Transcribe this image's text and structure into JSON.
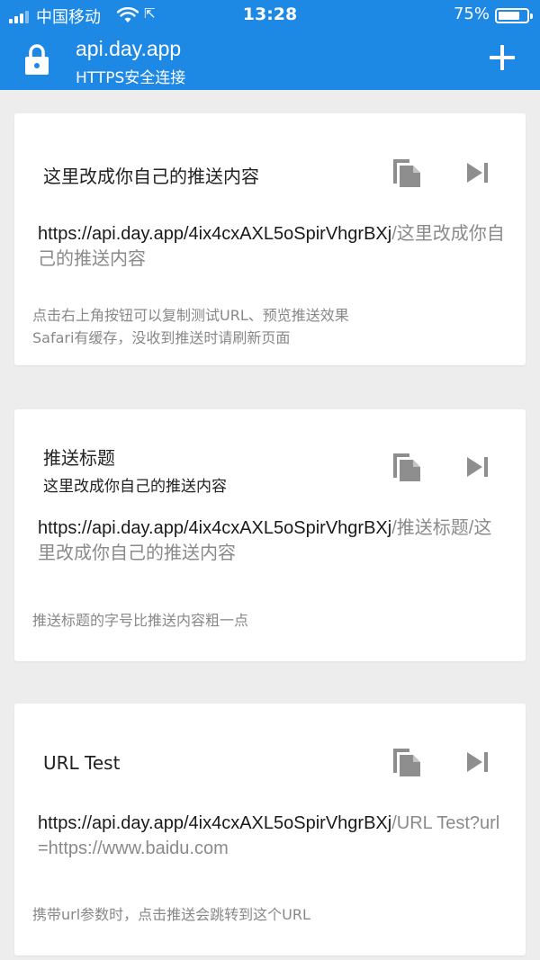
{
  "status_bar": {
    "carrier": "中国移动",
    "time": "13:28",
    "battery": "75%",
    "battery_level": 0.75
  },
  "header": {
    "site": "api.day.app",
    "security": "HTTPS安全连接"
  },
  "cards": [
    {
      "title": "这里改成你自己的推送内容",
      "subtitle": "",
      "url_base": "https://api.day.app/4ix4cxAXL5oSpirVhgrBXj",
      "url_tail": "/这里改成你自己的推送内容",
      "hint": "点击右上角按钮可以复制测试URL、预览推送效果\nSafari有缓存，没收到推送时请刷新页面"
    },
    {
      "title": "推送标题",
      "subtitle": "这里改成你自己的推送内容",
      "url_base": "https://api.day.app/4ix4cxAXL5oSpirVhgrBXj",
      "url_tail": "/推送标题/这里改成你自己的推送内容",
      "hint": "推送标题的字号比推送内容粗一点"
    },
    {
      "title": "URL Test",
      "subtitle": "",
      "url_base": "https://api.day.app/4ix4cxAXL5oSpirVhgrBXj",
      "url_tail": "/URL Test?url=https://www.baidu.com",
      "hint": "携带url参数时，点击推送会跳转到这个URL"
    }
  ],
  "colors": {
    "brand": "#1e88e5",
    "background": "#ededed",
    "icon_gray": "#8e8e8e"
  },
  "icons": [
    "lock-icon",
    "add-icon",
    "copy-icon",
    "play-next-icon",
    "wifi-icon",
    "signal-icon",
    "battery-icon"
  ]
}
